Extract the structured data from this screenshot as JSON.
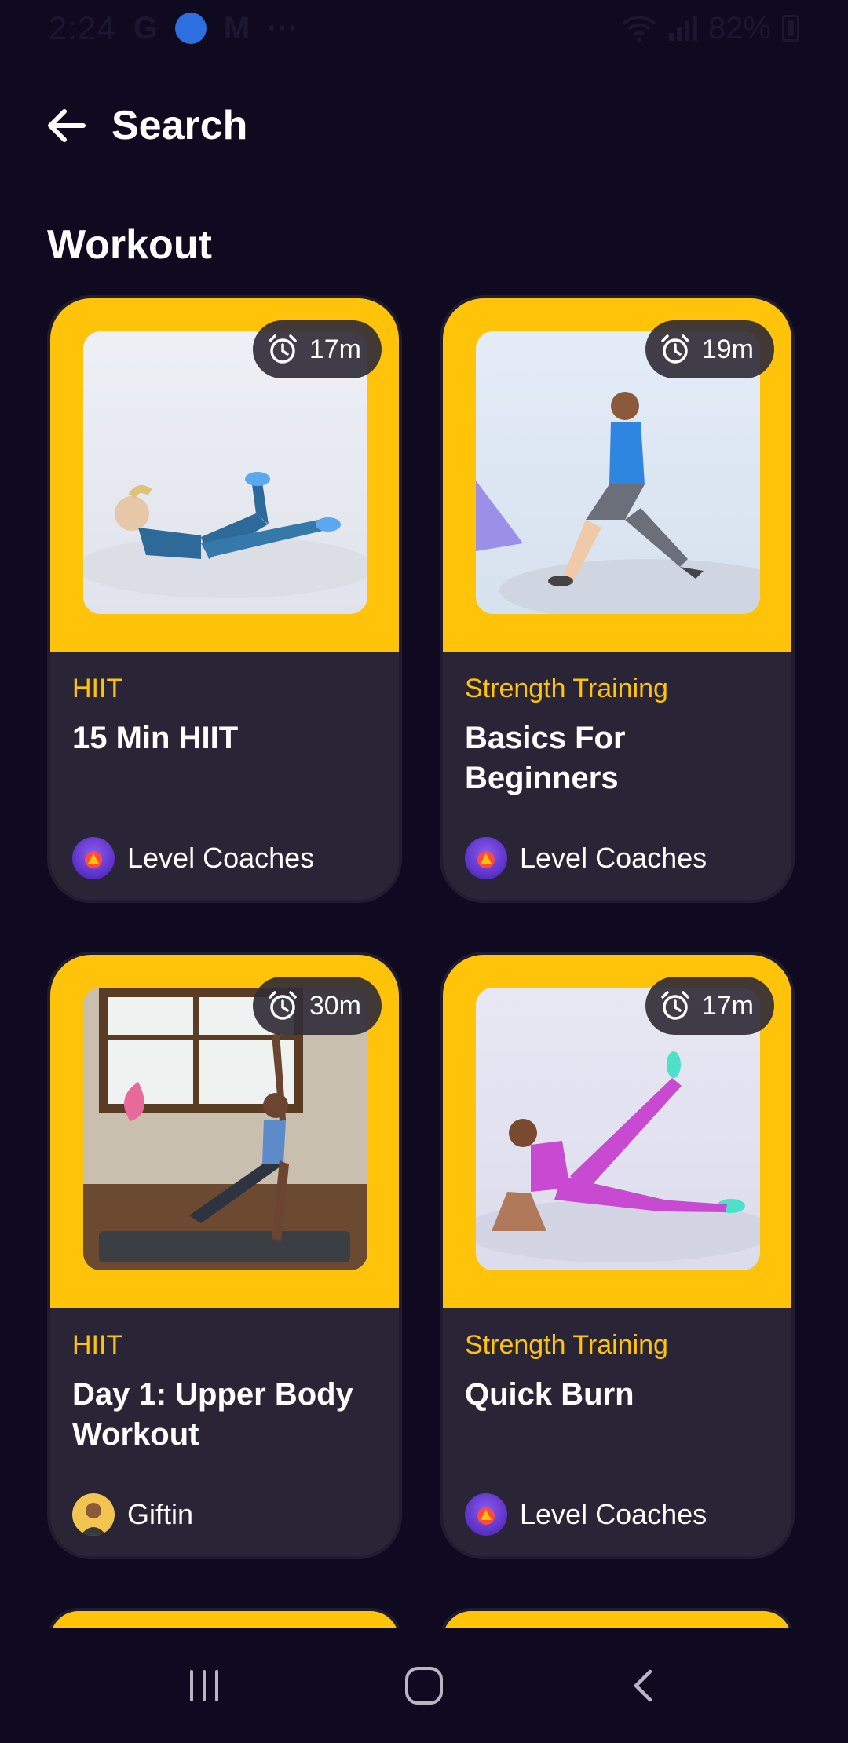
{
  "status_bar": {
    "time": "2:24",
    "battery": "82%",
    "notification_icons": [
      "google-icon",
      "app-icon",
      "gmail-icon",
      "more-icon"
    ]
  },
  "header": {
    "title": "Search"
  },
  "section": {
    "title": "Workout"
  },
  "cards": [
    {
      "duration": "17m",
      "category": "HIIT",
      "title": "15 Min HIIT",
      "author": "Level Coaches"
    },
    {
      "duration": "19m",
      "category": "Strength Training",
      "title": "Basics For Beginners",
      "author": "Level Coaches"
    },
    {
      "duration": "30m",
      "category": "HIIT",
      "title": "Day 1: Upper Body Workout",
      "author": "Giftin"
    },
    {
      "duration": "17m",
      "category": "Strength Training",
      "title": "Quick Burn",
      "author": "Level Coaches"
    }
  ],
  "colors": {
    "background": "#0f0a1f",
    "card_body": "#2a2536",
    "accent": "#ffc30a"
  }
}
